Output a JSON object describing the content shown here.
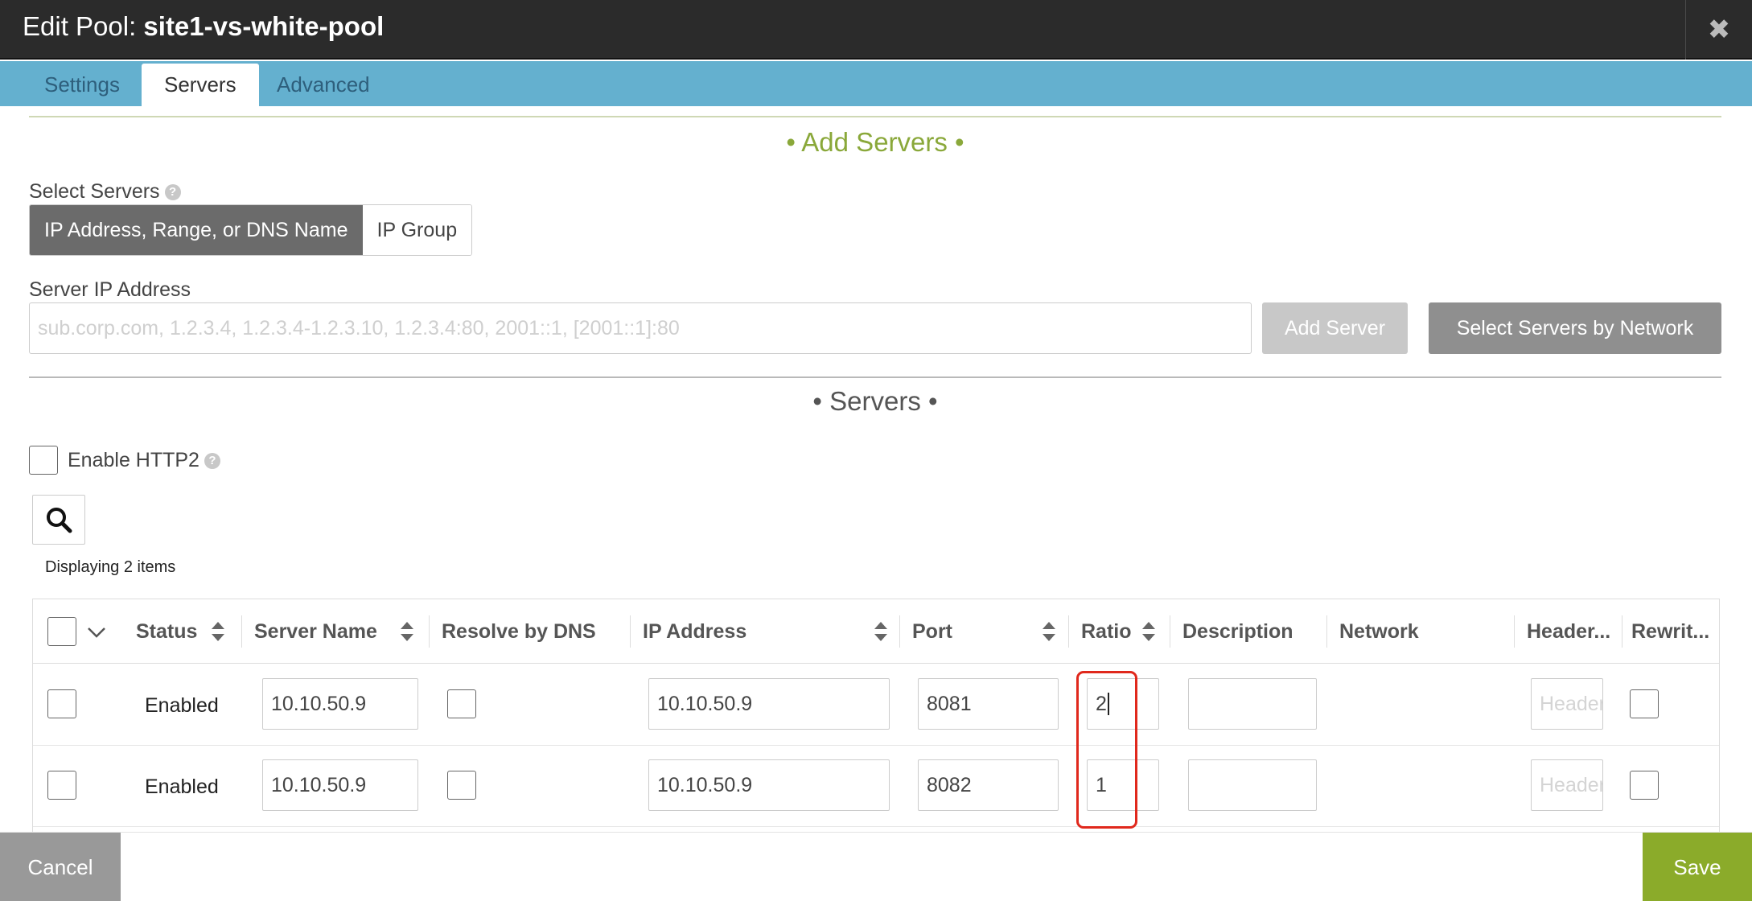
{
  "window": {
    "title_prefix": "Edit Pool:",
    "pool_name": "site1-vs-white-pool",
    "close_glyph": "✖"
  },
  "tabs": [
    {
      "label": "Settings",
      "active": false
    },
    {
      "label": "Servers",
      "active": true
    },
    {
      "label": "Advanced",
      "active": false
    }
  ],
  "add_servers": {
    "heading": "• Add Servers •",
    "select_label": "Select Servers",
    "modes": [
      "IP Address, Range, or DNS Name",
      "IP Group"
    ],
    "selected_mode": "IP Address, Range, or DNS Name",
    "ip_label": "Server IP Address",
    "ip_placeholder": "sub.corp.com, 1.2.3.4, 1.2.3.4-1.2.3.10, 1.2.3.4:80, 2001::1, [2001::1]:80",
    "ip_value": "",
    "add_button": "Add Server",
    "network_button": "Select Servers by Network"
  },
  "servers_section": {
    "heading": "• Servers •",
    "http2_label": "Enable HTTP2",
    "http2_checked": false,
    "count_text": "Displaying 2 items"
  },
  "grid": {
    "columns": [
      "Status",
      "Server Name",
      "Resolve by DNS",
      "IP Address",
      "Port",
      "Ratio",
      "Description",
      "Network",
      "Header...",
      "Rewrit..."
    ],
    "rows": [
      {
        "status": "Enabled",
        "server_name": "10.10.50.9",
        "ip": "10.10.50.9",
        "port": "8081",
        "ratio": "2",
        "description": "",
        "header_placeholder": "Header"
      },
      {
        "status": "Enabled",
        "server_name": "10.10.50.9",
        "ip": "10.10.50.9",
        "port": "8082",
        "ratio": "1",
        "description": "",
        "header_placeholder": "Header"
      }
    ]
  },
  "footer": {
    "cancel": "Cancel",
    "save": "Save"
  },
  "colors": {
    "titlebar": "#2b2b2b",
    "tabbar": "#64b0cf",
    "add_heading": "#8aa83a",
    "save": "#8bab2a",
    "cancel": "#999999",
    "highlight": "#e0281c"
  },
  "icons": {
    "close": "close-icon",
    "search": "search-icon",
    "help": "help-icon",
    "sort": "sort-icon",
    "dropdown": "chevron-down-icon"
  }
}
